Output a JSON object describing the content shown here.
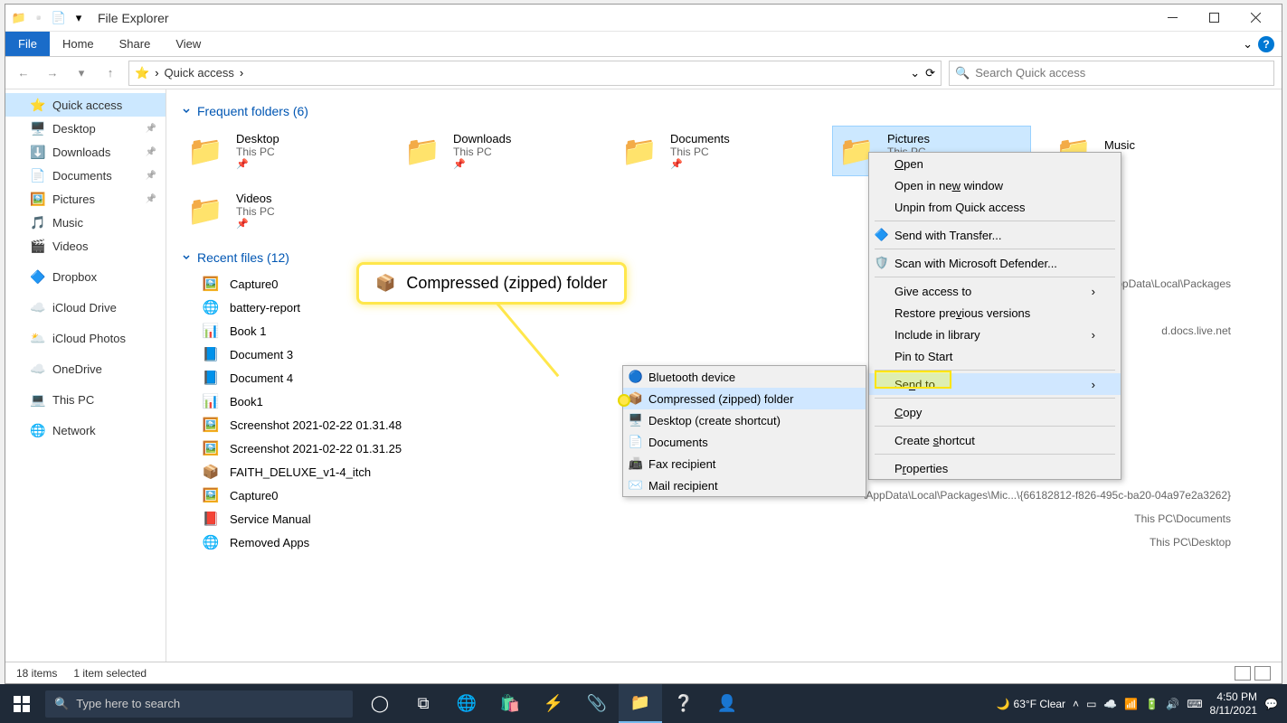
{
  "window": {
    "title": "File Explorer"
  },
  "ribbon": {
    "file": "File",
    "tabs": [
      "Home",
      "Share",
      "View"
    ]
  },
  "breadcrumb": {
    "root_icon": "⭐",
    "segments": [
      "Quick access"
    ]
  },
  "search": {
    "placeholder": "Search Quick access"
  },
  "sidebar": [
    {
      "icon": "⭐",
      "label": "Quick access",
      "selected": true
    },
    {
      "icon": "🖥️",
      "label": "Desktop",
      "pinned": true
    },
    {
      "icon": "⬇️",
      "label": "Downloads",
      "pinned": true
    },
    {
      "icon": "📄",
      "label": "Documents",
      "pinned": true
    },
    {
      "icon": "🖼️",
      "label": "Pictures",
      "pinned": true
    },
    {
      "icon": "🎵",
      "label": "Music"
    },
    {
      "icon": "🎬",
      "label": "Videos"
    },
    {
      "icon": "🔷",
      "label": "Dropbox"
    },
    {
      "icon": "☁️",
      "label": "iCloud Drive"
    },
    {
      "icon": "🌥️",
      "label": "iCloud Photos"
    },
    {
      "icon": "☁️",
      "label": "OneDrive"
    },
    {
      "icon": "💻",
      "label": "This PC"
    },
    {
      "icon": "🌐",
      "label": "Network"
    }
  ],
  "groups": {
    "frequent": {
      "title": "Frequent folders (6)",
      "items": [
        {
          "name": "Desktop",
          "loc": "This PC",
          "icon": "📁"
        },
        {
          "name": "Downloads",
          "loc": "This PC",
          "icon": "📁"
        },
        {
          "name": "Documents",
          "loc": "This PC",
          "icon": "📁"
        },
        {
          "name": "Pictures",
          "loc": "This PC",
          "icon": "📁",
          "selected": true
        },
        {
          "name": "Music",
          "loc": "",
          "icon": "📁"
        },
        {
          "name": "Videos",
          "loc": "This PC",
          "icon": "📁"
        }
      ]
    },
    "recent": {
      "title": "Recent files (12)",
      "items": [
        {
          "name": "Capture0",
          "icon": "🖼️",
          "path": "\\AppData\\Local\\Packages"
        },
        {
          "name": "battery-report",
          "icon": "🌐",
          "path": ""
        },
        {
          "name": "Book 1",
          "icon": "📊",
          "path": "d.docs.live.net"
        },
        {
          "name": "Document 3",
          "icon": "📘",
          "path": ""
        },
        {
          "name": "Document 4",
          "icon": "📘",
          "path": ""
        },
        {
          "name": "Book1",
          "icon": "📊",
          "path": ""
        },
        {
          "name": "Screenshot 2021-02-22 01.31.48",
          "icon": "🖼️",
          "path": ""
        },
        {
          "name": "Screenshot 2021-02-22 01.31.25",
          "icon": "🖼️",
          "path": ""
        },
        {
          "name": "FAITH_DELUXE_v1-4_itch",
          "icon": "📦",
          "path": ""
        },
        {
          "name": "Capture0",
          "icon": "🖼️",
          "path": "\\AppData\\Local\\Packages\\Mic...\\{66182812-f826-495c-ba20-04a97e2a3262}"
        },
        {
          "name": "Service Manual",
          "icon": "📕",
          "path": "This PC\\Documents"
        },
        {
          "name": "Removed Apps",
          "icon": "🌐",
          "path": "This PC\\Desktop"
        }
      ]
    }
  },
  "context_main": [
    {
      "label": "Open",
      "accel": "O"
    },
    {
      "label": "Open in new window",
      "accel": "w"
    },
    {
      "label": "Unpin from Quick access"
    },
    {
      "sep": true
    },
    {
      "label": "Send with Transfer...",
      "icon": "🔷"
    },
    {
      "sep": true
    },
    {
      "label": "Scan with Microsoft Defender...",
      "icon": "🛡️"
    },
    {
      "sep": true
    },
    {
      "label": "Give access to",
      "arrow": true
    },
    {
      "label": "Restore previous versions",
      "accel": "v"
    },
    {
      "label": "Include in library",
      "arrow": true
    },
    {
      "label": "Pin to Start"
    },
    {
      "sep": true
    },
    {
      "label": "Send to",
      "accel": "n",
      "arrow": true,
      "hl": true
    },
    {
      "sep": true
    },
    {
      "label": "Copy",
      "accel": "C"
    },
    {
      "sep": true
    },
    {
      "label": "Create shortcut",
      "accel": "s"
    },
    {
      "sep": true
    },
    {
      "label": "Properties",
      "accel": "r"
    }
  ],
  "context_sendto": [
    {
      "label": "Bluetooth device",
      "icon": "🔵"
    },
    {
      "label": "Compressed (zipped) folder",
      "icon": "📦",
      "hl": true
    },
    {
      "label": "Desktop (create shortcut)",
      "icon": "🖥️"
    },
    {
      "label": "Documents",
      "icon": "📄"
    },
    {
      "label": "Fax recipient",
      "icon": "📠"
    },
    {
      "label": "Mail recipient",
      "icon": "✉️"
    }
  ],
  "callout": {
    "icon": "📦",
    "label": "Compressed (zipped) folder"
  },
  "statusbar": {
    "items": "18 items",
    "selected": "1 item selected"
  },
  "taskbar": {
    "search_placeholder": "Type here to search",
    "weather": "63°F  Clear",
    "time": "4:50 PM",
    "date": "8/11/2021"
  }
}
